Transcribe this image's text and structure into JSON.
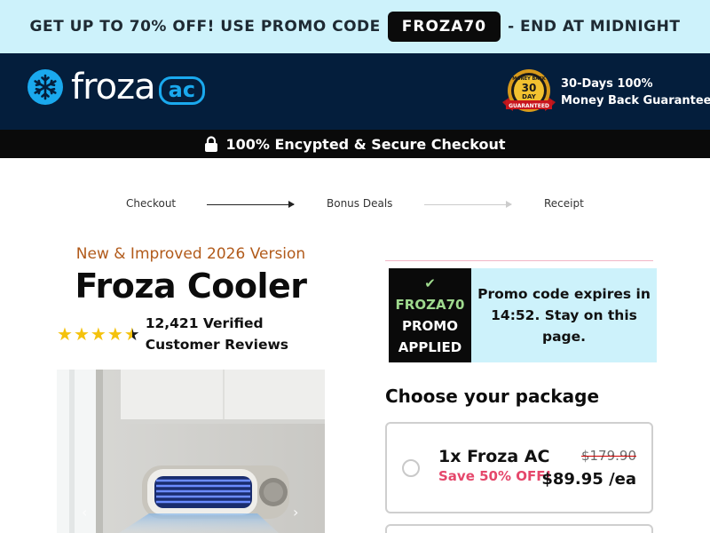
{
  "promo_bar": {
    "text_before": "GET UP TO 70% OFF! USE PROMO CODE",
    "code": "FROZA70",
    "text_after": "- END AT MIDNIGHT"
  },
  "header": {
    "logo_word": "froza",
    "logo_badge": "ac",
    "seal": {
      "line1": "MONEY BACK",
      "line2": "30",
      "line3": "DAY",
      "line4": "GUARANTEED"
    },
    "guarantee_line1": "30-Days 100%",
    "guarantee_line2": "Money Back Guarantee"
  },
  "secure_bar": {
    "text": "100% Encypted & Secure Checkout"
  },
  "steps": [
    "Checkout",
    "Bonus Deals",
    "Receipt"
  ],
  "product": {
    "subheading": "New & Improved 2026 Version",
    "title": "Froza Cooler",
    "rating": 4.5,
    "reviews_line1": "12,421 Verified",
    "reviews_line2": "Customer Reviews"
  },
  "promo_applied": {
    "check": "✔",
    "code": "FROZA70",
    "line2": "PROMO",
    "line3": "APPLIED",
    "message": "Promo code expires in 14:52. Stay on this page."
  },
  "packages_heading": "Choose your package",
  "packages": [
    {
      "name": "1x Froza AC",
      "save": "Save 50% OFF!",
      "old_price": "$179.90",
      "price": "$89.95 /ea"
    }
  ],
  "colors": {
    "promo_bg": "#cdf2fb",
    "header_bg": "#041e3c",
    "accent": "#1aa9ee",
    "save_pink": "#e5476b",
    "subhead_orange": "#b15a1a",
    "promo_green": "#9ed98d"
  }
}
